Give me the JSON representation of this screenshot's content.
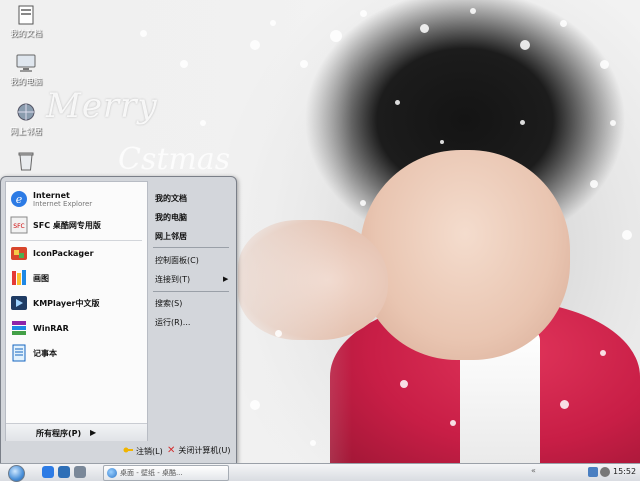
{
  "desktop": {
    "icons": [
      {
        "label": "我的文档",
        "icon": "my-documents-icon"
      },
      {
        "label": "我的电脑",
        "icon": "my-computer-icon"
      },
      {
        "label": "网上邻居",
        "icon": "network-places-icon"
      },
      {
        "label": "",
        "icon": "recycle-bin-icon"
      }
    ],
    "wallpaper_text": [
      "Merry",
      "Cstmas"
    ]
  },
  "start_menu": {
    "pinned": [
      {
        "title": "Internet",
        "subtitle": "Internet Explorer",
        "icon": "internet-explorer-icon"
      },
      {
        "title": "SFC 桌酷网专用版",
        "icon": "sfc-icon"
      }
    ],
    "recent": [
      {
        "title": "IconPackager",
        "icon": "iconpackager-icon"
      },
      {
        "title": "画图",
        "icon": "paint-icon"
      },
      {
        "title": "KMPlayer中文版",
        "icon": "kmplayer-icon"
      },
      {
        "title": "WinRAR",
        "icon": "winrar-icon"
      },
      {
        "title": "记事本",
        "icon": "notepad-icon"
      }
    ],
    "all_programs": "所有程序(P)",
    "right": {
      "bold_items": [
        "我的文档",
        "我的电脑",
        "网上邻居"
      ],
      "items": [
        "控制面板(C)",
        "连接到(T)",
        "搜索(S)",
        "运行(R)..."
      ]
    },
    "logoff": "注销(L)",
    "shutdown": "关闭计算机(U)"
  },
  "taskbar": {
    "task_label": "桌面 - 壁纸 - 桌酷...",
    "clock": "15:52",
    "tray_arrow": "«"
  },
  "colors": {
    "jacket": "#c81e46",
    "taskbar": "#d9dce1",
    "menu_bg": "#d3d6db"
  }
}
